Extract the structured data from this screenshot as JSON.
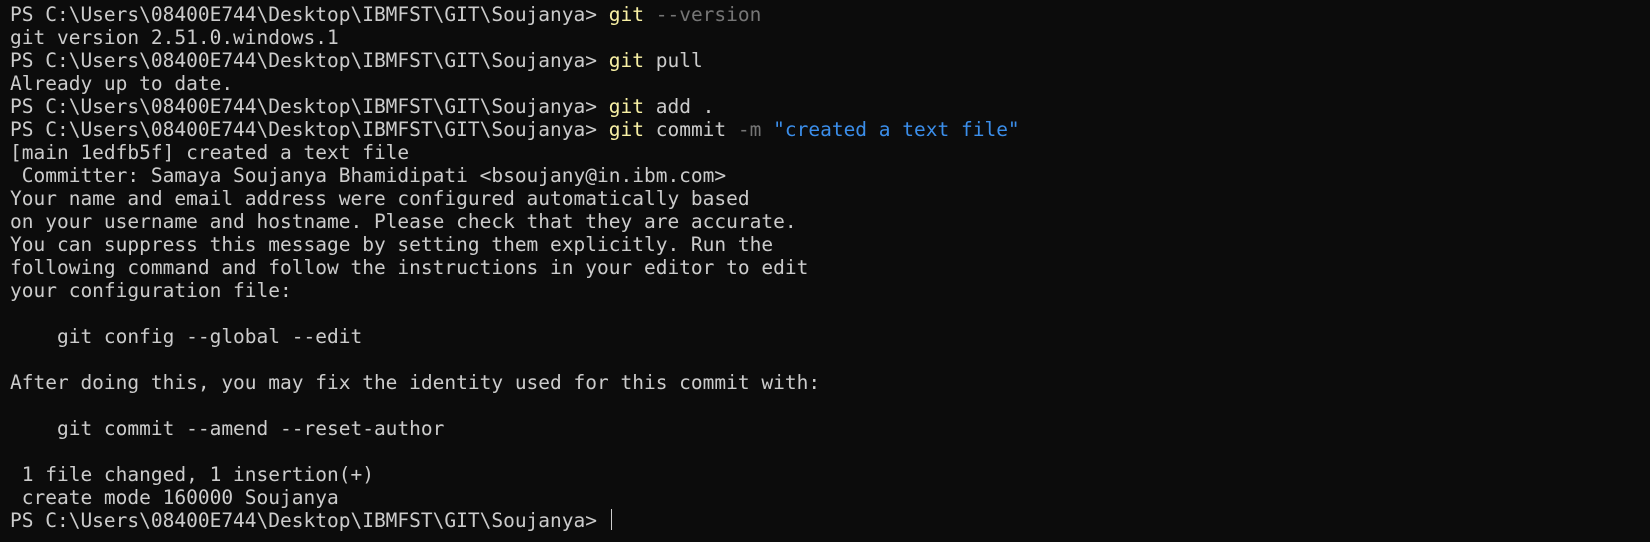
{
  "terminal": {
    "lines": [
      {
        "prompt": "PS C:\\Users\\08400E744\\Desktop\\IBMFST\\GIT\\Soujanya> ",
        "cmd": "git",
        "flag": " --version",
        "rest": ""
      },
      {
        "text": "git version 2.51.0.windows.1"
      },
      {
        "prompt": "PS C:\\Users\\08400E744\\Desktop\\IBMFST\\GIT\\Soujanya> ",
        "cmd": "git",
        "rest": " pull"
      },
      {
        "text": "Already up to date."
      },
      {
        "prompt": "PS C:\\Users\\08400E744\\Desktop\\IBMFST\\GIT\\Soujanya> ",
        "cmd": "git",
        "rest": " add ."
      },
      {
        "prompt": "PS C:\\Users\\08400E744\\Desktop\\IBMFST\\GIT\\Soujanya> ",
        "cmd": "git",
        "rest": " commit ",
        "flag": "-m",
        "str": " \"created a text file\""
      },
      {
        "text": "[main 1edfb5f] created a text file"
      },
      {
        "text": " Committer: Samaya Soujanya Bhamidipati <bsoujany@in.ibm.com>"
      },
      {
        "text": "Your name and email address were configured automatically based"
      },
      {
        "text": "on your username and hostname. Please check that they are accurate."
      },
      {
        "text": "You can suppress this message by setting them explicitly. Run the"
      },
      {
        "text": "following command and follow the instructions in your editor to edit"
      },
      {
        "text": "your configuration file:"
      },
      {
        "text": ""
      },
      {
        "text": "    git config --global --edit"
      },
      {
        "text": ""
      },
      {
        "text": "After doing this, you may fix the identity used for this commit with:"
      },
      {
        "text": ""
      },
      {
        "text": "    git commit --amend --reset-author"
      },
      {
        "text": ""
      },
      {
        "text": " 1 file changed, 1 insertion(+)"
      },
      {
        "text": " create mode 160000 Soujanya"
      }
    ],
    "current_prompt": "PS C:\\Users\\08400E744\\Desktop\\IBMFST\\GIT\\Soujanya> "
  }
}
